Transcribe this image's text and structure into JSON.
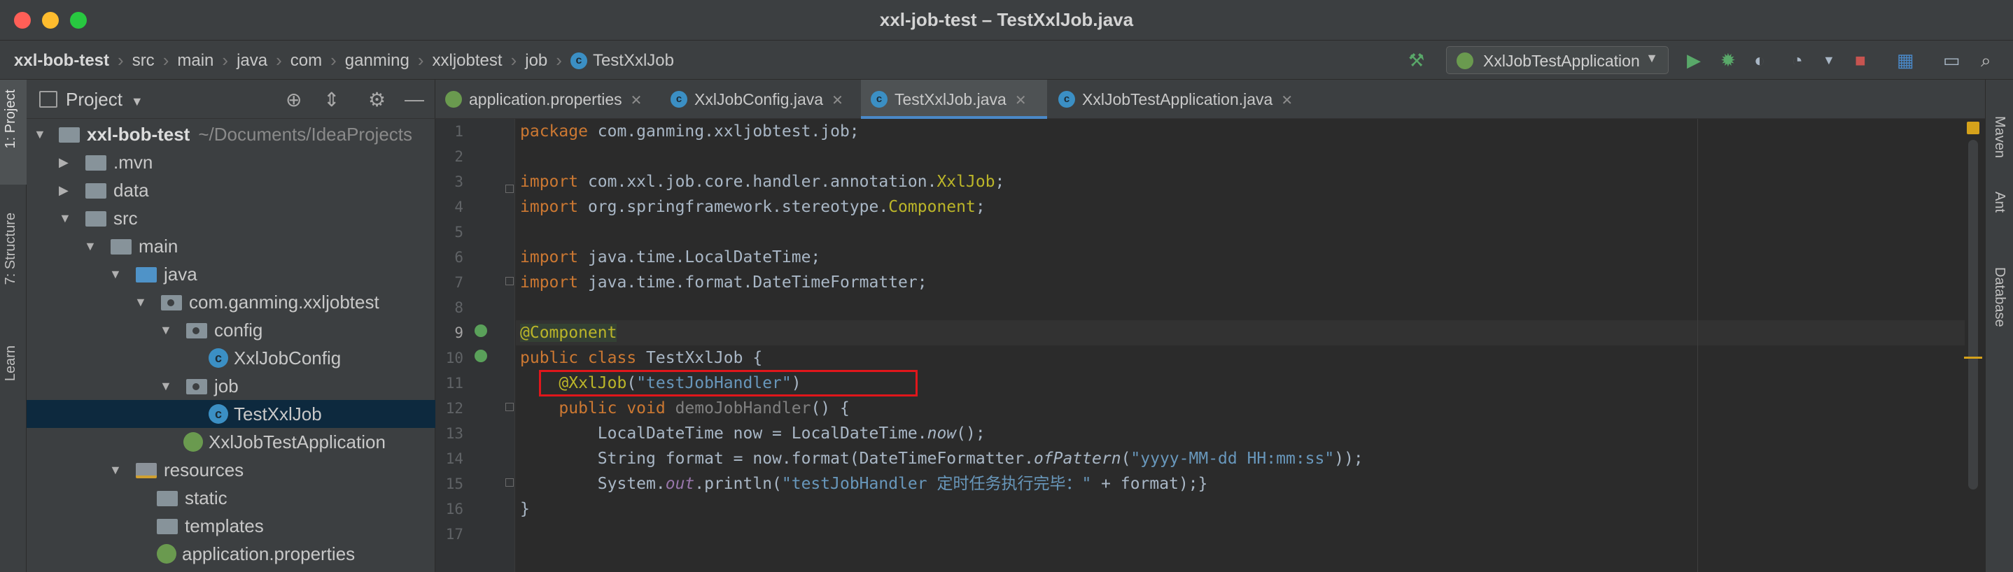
{
  "window": {
    "title": "xxl-job-test – TestXxlJob.java"
  },
  "breadcrumbs": [
    "xxl-bob-test",
    "src",
    "main",
    "java",
    "com",
    "ganming",
    "xxljobtest",
    "job",
    "TestXxlJob"
  ],
  "toolbar": {
    "run_config": "XxlJobTestApplication",
    "icons": [
      "hammer-icon",
      "run-icon",
      "debug-icon",
      "coverage-icon",
      "profile-icon",
      "stop-icon",
      "project-structure-icon",
      "layout-icon",
      "search-icon"
    ]
  },
  "left_stripe": [
    "1: Project",
    "7: Structure",
    "Learn"
  ],
  "right_stripe": [
    "Maven",
    "Ant",
    "Database"
  ],
  "project": {
    "title": "Project",
    "tree": [
      {
        "label": "xxl-bob-test",
        "hint": "~/Documents/IdeaProjects",
        "bold": true
      },
      {
        "label": ".mvn"
      },
      {
        "label": "data"
      },
      {
        "label": "src"
      },
      {
        "label": "main"
      },
      {
        "label": "java"
      },
      {
        "label": "com.ganming.xxljobtest"
      },
      {
        "label": "config"
      },
      {
        "label": "XxlJobConfig"
      },
      {
        "label": "job"
      },
      {
        "label": "TestXxlJob",
        "selected": true
      },
      {
        "label": "XxlJobTestApplication"
      },
      {
        "label": "resources"
      },
      {
        "label": "static"
      },
      {
        "label": "templates"
      },
      {
        "label": "application.properties"
      }
    ]
  },
  "tabs": [
    {
      "label": "application.properties"
    },
    {
      "label": "XxlJobConfig.java"
    },
    {
      "label": "TestXxlJob.java",
      "active": true
    },
    {
      "label": "XxlJobTestApplication.java"
    }
  ],
  "editor": {
    "line_numbers": [
      "1",
      "2",
      "3",
      "4",
      "5",
      "6",
      "7",
      "8",
      "9",
      "10",
      "11",
      "12",
      "13",
      "14",
      "15",
      "16",
      "17"
    ],
    "code": {
      "l1_kw": "package",
      "l1_rest": " com.ganming.xxljobtest.job;",
      "l3_kw": "import",
      "l3_rest": " com.xxl.job.core.handler.annotation.",
      "l3_cls": "XxlJob",
      "l3_end": ";",
      "l4_kw": "import",
      "l4_rest": " org.springframework.stereotype.",
      "l4_cls": "Component",
      "l4_end": ";",
      "l6_kw": "import",
      "l6_rest": " java.time.LocalDateTime;",
      "l7_kw": "import",
      "l7_rest": " java.time.format.DateTimeFormatter;",
      "l9_ann": "@Component",
      "l10_kw": "public class",
      "l10_rest": " TestXxlJob {",
      "l11_ann": "@XxlJob",
      "l11_open": "(",
      "l11_str": "\"testJobHandler\"",
      "l11_close": ")",
      "l12_kw": "public void",
      "l12_name": " demoJobHandler",
      "l12_rest": "() {",
      "l13_a": "LocalDateTime ",
      "l13_var": "now",
      "l13_b": " = LocalDateTime.",
      "l13_fn": "now",
      "l13_c": "();",
      "l14_a": "String ",
      "l14_var": "format",
      "l14_b": " = ",
      "l14_now": "now",
      "l14_c": ".format(DateTimeFormatter.",
      "l14_fn": "ofPattern",
      "l14_d": "(",
      "l14_str": "\"yyyy-MM-dd HH:mm:ss\"",
      "l14_e": "));",
      "l15_a": "System.",
      "l15_out": "out",
      "l15_b": ".println(",
      "l15_str": "\"testJobHandler 定时任务执行完毕：\"",
      "l15_c": " + ",
      "l15_var": "format",
      "l15_d": ");}",
      "l16": "}"
    }
  },
  "colors": {
    "keyword": "#cc7832",
    "annotation": "#bbb529",
    "string": "#6a8759",
    "highlight_box": "#e0161b",
    "background": "#2b2b2b"
  }
}
